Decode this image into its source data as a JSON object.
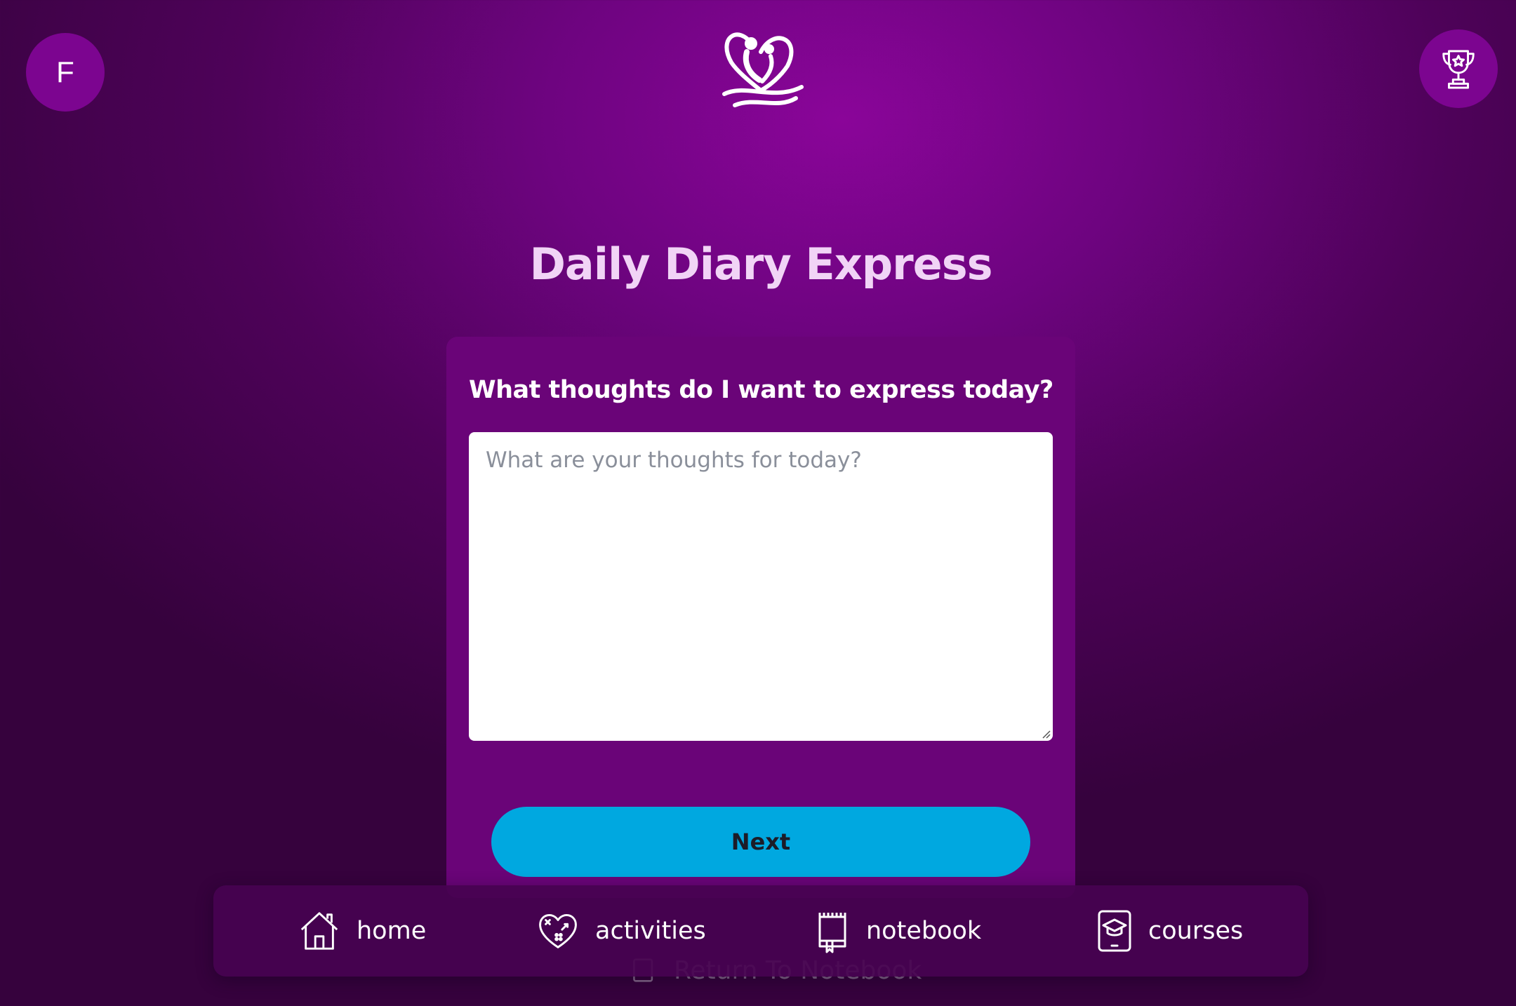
{
  "header": {
    "avatar_initial": "F",
    "logo_icon": "butterfly-heart-logo",
    "trophy_icon": "trophy-icon"
  },
  "page": {
    "title": "Daily Diary Express"
  },
  "form": {
    "question": "What thoughts do I want to express today?",
    "input_placeholder": "What are your thoughts for today?",
    "input_value": "",
    "next_label": "Next"
  },
  "background_link": {
    "label": "Return To Notebook"
  },
  "nav": {
    "items": [
      {
        "label": "home",
        "icon": "house-icon"
      },
      {
        "label": "activities",
        "icon": "heart-puzzle-icon"
      },
      {
        "label": "notebook",
        "icon": "notebook-icon"
      },
      {
        "label": "courses",
        "icon": "graduation-tablet-icon"
      }
    ]
  },
  "colors": {
    "background": "#6e0480",
    "card": "#6a0478",
    "title": "#f1d4f6",
    "button": "#00a8e0",
    "nav_bar": "#460250"
  }
}
